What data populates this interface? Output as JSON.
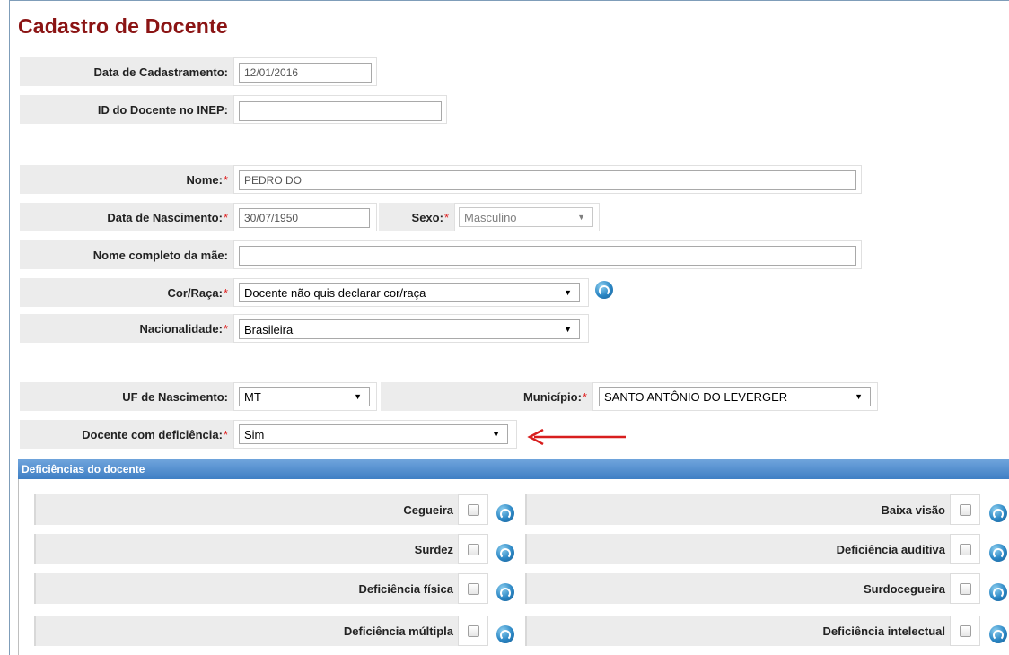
{
  "page_title": "Cadastro de Docente",
  "fields": {
    "data_cadastramento": {
      "label": "Data de Cadastramento:",
      "value": "12/01/2016"
    },
    "id_inep": {
      "label": "ID do Docente no INEP:",
      "value": ""
    },
    "nome": {
      "label": "Nome:",
      "required": "*",
      "value": "PEDRO DO"
    },
    "data_nascimento": {
      "label": "Data de Nascimento:",
      "required": "*",
      "value": "30/07/1950"
    },
    "sexo": {
      "label": "Sexo:",
      "required": "*",
      "value": "Masculino"
    },
    "nome_mae": {
      "label": "Nome completo da mãe:",
      "value": ""
    },
    "cor_raca": {
      "label": "Cor/Raça:",
      "required": "*",
      "value": "Docente não quis declarar cor/raça"
    },
    "nacionalidade": {
      "label": "Nacionalidade:",
      "required": "*",
      "value": "Brasileira"
    },
    "uf_nascimento": {
      "label": "UF de Nascimento:",
      "value": "MT"
    },
    "municipio": {
      "label": "Município:",
      "required": "*",
      "value": "SANTO ANTÔNIO DO LEVERGER"
    },
    "deficiencia": {
      "label": "Docente com deficiência:",
      "required": "*",
      "value": "Sim"
    }
  },
  "deficiencias_section": {
    "title": "Deficiências do docente",
    "left": [
      {
        "label": "Cegueira",
        "checked": false
      },
      {
        "label": "Surdez",
        "checked": false
      },
      {
        "label": "Deficiência física",
        "checked": false
      },
      {
        "label": "Deficiência múltipla",
        "checked": false
      }
    ],
    "right": [
      {
        "label": "Baixa visão",
        "checked": false
      },
      {
        "label": "Deficiência auditiva",
        "checked": false
      },
      {
        "label": "Surdocegueira",
        "checked": false
      },
      {
        "label": "Deficiência intelectual",
        "checked": false
      }
    ]
  },
  "colors": {
    "title": "#8b1414",
    "required_marker": "#e02020",
    "annotation_arrow": "#d81e1e",
    "section_header": "#4f8ccc"
  },
  "icons": {
    "help": "help-icon",
    "dropdown": "chevron-down-icon",
    "annotation": "red-arrow-icon"
  }
}
